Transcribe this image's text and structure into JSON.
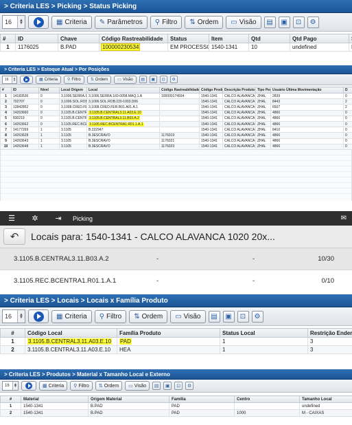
{
  "panel1": {
    "title": "> Criteria LES > Picking > Status Picking",
    "toolbar": {
      "page_size": "16",
      "criteria": "Criteria",
      "parametros": "Parâmetros",
      "filtro": "Filtro",
      "ordem": "Ordem",
      "visao": "Visão"
    },
    "columns": [
      "#",
      "ID",
      "Chave",
      "Código Rastreabilidade",
      "Status",
      "Item",
      "Qtd",
      "Qtd Pago",
      "S"
    ],
    "rows": [
      [
        "1",
        "1176025",
        "B.PAD",
        "100000230534",
        "EM PROCESSO",
        "1540-1341",
        "10",
        "undefined",
        "N"
      ]
    ]
  },
  "panel2": {
    "title": "> Criteria LES > Estoque Atual > Por Posições",
    "toolbar": {
      "page_size": "16",
      "criteria": "Criteria",
      "filtro": "Filtro",
      "ordem": "Ordem",
      "visao": "Visão"
    },
    "columns": [
      "#",
      "ID",
      "Nível",
      "Local Origem",
      "Local",
      "Código Rastreabilidade",
      "Código Produto",
      "Descrição Produto",
      "Tipo Peça",
      "Usuário Última Movimentação",
      "D"
    ],
    "rows": [
      [
        "1",
        "14183536",
        "0",
        "3.1006.SERRA.1",
        "3.1006.SERRA.160-0058.MAQ.1.A",
        "100000174934",
        "1540-1341",
        "CALCO ALAVANCA 1",
        "ZHAL",
        "2839",
        "0"
      ],
      [
        "2",
        "702707",
        "0",
        "3.1006.SOL.ROB",
        "3.1006.SOL.ROB.220-1003.D06",
        "",
        "1540-1341",
        "CALCO ALAVANCA 1",
        "ZHAL",
        "8443",
        "2"
      ],
      [
        "3",
        "12842852",
        "0",
        "3.1008.CRED.FE",
        "3.1008.CRED.FER.R01.A01.A.1",
        "",
        "1540-1341",
        "CALCO ALAVANCA 1",
        "ZHAL",
        "6507",
        "2"
      ],
      [
        "4",
        "14263660",
        "0",
        "3.1105.B.CENTR",
        "3.1105.B.CENTRAL3.11.A03.E.10",
        "",
        "1540-1341",
        "CALCO ALAVANCA 1",
        "ZHAL",
        "4866",
        "0"
      ],
      [
        "5",
        "830219",
        "0",
        "3.1105.B.CENTR",
        "3.1105.B.CENTRAL3.11.B03.A.2",
        "",
        "1540-1341",
        "CALCO ALAVANCA 1",
        "ZHAL",
        "4866",
        "0"
      ],
      [
        "6",
        "14263662",
        "0",
        "3.1105.REC.BCE",
        "3.1105.REC.BCENTRA1.R01.1.A.1",
        "",
        "1540-1341",
        "CALCO ALAVANCA 1",
        "ZHAL",
        "4866",
        "0"
      ],
      [
        "7",
        "14177269",
        "1",
        "3.1105",
        "B.222947",
        "",
        "1540-1341",
        "CALCO ALAVANCA 1",
        "ZHAL",
        "8410",
        "0"
      ],
      [
        "8",
        "14263628",
        "1",
        "3.1105",
        "B.3ESCRAVO",
        "1176019",
        "1540-1341",
        "CALCO ALAVANCA 1",
        "ZHAL",
        "4866",
        "0"
      ],
      [
        "9",
        "14263643",
        "1",
        "3.1105",
        "B.3ESCRAVO",
        "1176021",
        "1540-1341",
        "CALCO ALAVANCA 1",
        "ZHAL",
        "4866",
        "0"
      ],
      [
        "10",
        "14263648",
        "1",
        "3.1105",
        "B.3ESCRAVO",
        "1176023",
        "1540-1341",
        "CALCO ALAVANCA 1",
        "ZHAL",
        "4866",
        "0"
      ]
    ]
  },
  "panel3": {
    "app_title": "Picking",
    "header": "Locais para: 1540-1341 - CALCO ALAVANCA 1020 20x...",
    "rows": [
      {
        "local": "3.1105.B.CENTRAL3.11.B03.A.2",
        "col2": "-",
        "col3": "-",
        "qty": "10/30"
      },
      {
        "local": "3.1105.REC.BCENTRA1.R01.1.A.1",
        "col2": "-",
        "col3": "-",
        "qty": "0/10"
      }
    ]
  },
  "panel4": {
    "title": "> Criteria LES > Locais > Locais x Família Produto",
    "toolbar": {
      "page_size": "16",
      "criteria": "Criteria",
      "filtro": "Filtro",
      "ordem": "Ordem",
      "visao": "Visão"
    },
    "columns": [
      "#",
      "Código Local",
      "Família Produto",
      "Status Local",
      "Restrição Endere"
    ],
    "rows": [
      [
        "1",
        "3.1105.B.CENTRAL3.11.A03.E.10",
        "PAD",
        "1",
        "3"
      ],
      [
        "2",
        "3.1105.B.CENTRAL3.11.A03.E.10",
        "HEA",
        "1",
        "3"
      ]
    ]
  },
  "panel5": {
    "title": "> Criteria LES > Produtos > Material x Tamanho Local e Externo",
    "toolbar": {
      "page_size": "16",
      "criteria": "Criteria",
      "filtro": "Filtro",
      "ordem": "Ordem",
      "visao": "Visão"
    },
    "columns": [
      "#",
      "Material",
      "Origem Material",
      "Família",
      "Centro",
      "Tamanho Local"
    ],
    "rows": [
      [
        "1",
        "1540-1341",
        "B.PAD",
        "PAD",
        "",
        "undefined"
      ],
      [
        "2",
        "1540-1341",
        "B.PAD",
        "PAD",
        "1000",
        "M - CAIXAS"
      ]
    ]
  }
}
